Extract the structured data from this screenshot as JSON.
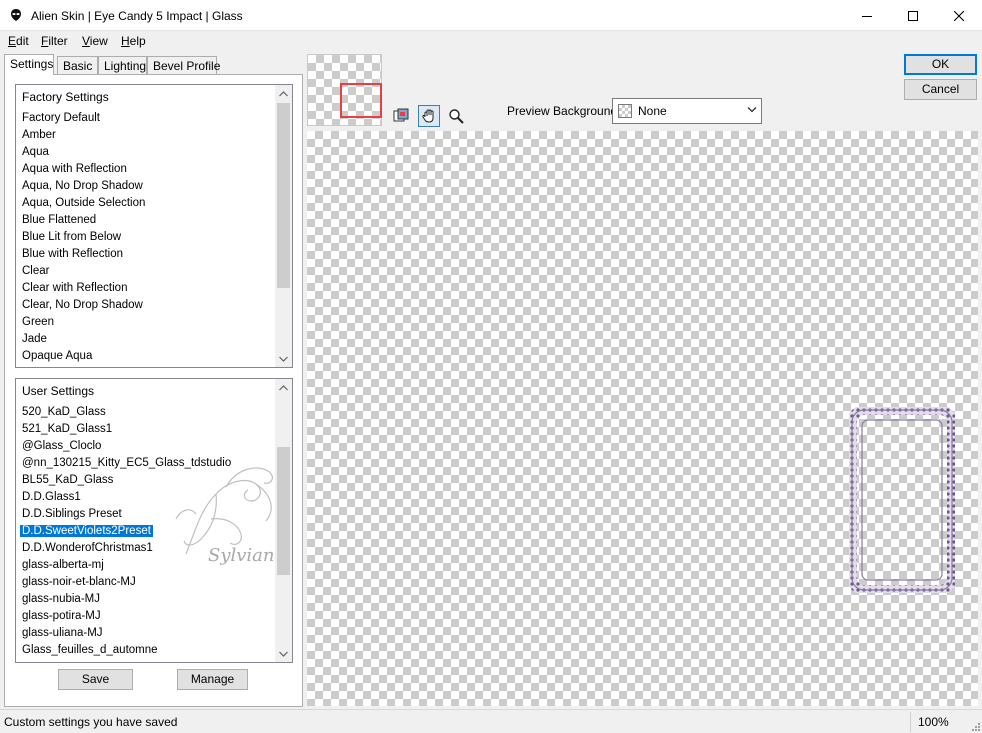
{
  "window": {
    "title": "Alien Skin | Eye Candy 5 Impact | Glass",
    "buttons": [
      "minimize-icon",
      "maximize-icon",
      "close-icon"
    ]
  },
  "menu": {
    "items": [
      {
        "mnemonic": "E",
        "rest": "dit"
      },
      {
        "mnemonic": "F",
        "rest": "ilter"
      },
      {
        "mnemonic": "V",
        "rest": "iew"
      },
      {
        "mnemonic": "H",
        "rest": "elp"
      }
    ]
  },
  "tabs": [
    "Settings",
    "Basic",
    "Lighting",
    "Bevel Profile"
  ],
  "factory": {
    "header": "Factory Settings",
    "items": [
      "Factory Default",
      "Amber",
      "Aqua",
      "Aqua with Reflection",
      "Aqua, No Drop Shadow",
      "Aqua, Outside Selection",
      "Blue Flattened",
      "Blue Lit from Below",
      "Blue with Reflection",
      "Clear",
      "Clear with Reflection",
      "Clear, No Drop Shadow",
      "Green",
      "Jade",
      "Opaque Aqua"
    ]
  },
  "user": {
    "header": "User Settings",
    "selected_index": 7,
    "items": [
      "520_KaD_Glass",
      "521_KaD_Glass1",
      "@Glass_Cloclo",
      "@nn_130215_Kitty_EC5_Glass_tdstudio",
      "BL55_KaD_Glass",
      "D.D.Glass1",
      "D.D.Siblings Preset",
      "D.D.SweetViolets2Preset",
      "D.D.WonderofChristmas1",
      "glass-alberta-mj",
      "glass-noir-et-blanc-MJ",
      "glass-nubia-MJ",
      "glass-potira-MJ",
      "glass-uliana-MJ",
      "Glass_feuilles_d_automne"
    ]
  },
  "watermark": "Sylviane",
  "actions": {
    "save": "Save",
    "manage": "Manage",
    "ok": "OK",
    "cancel": "Cancel"
  },
  "preview": {
    "background_label": "Preview Background:",
    "background_value": "None",
    "tools": [
      "preview-toggle-icon",
      "hand-icon",
      "zoom-icon"
    ]
  },
  "status": {
    "message": "Custom settings you have saved",
    "zoom": "100%"
  },
  "colors": {
    "selection": "#0078d7",
    "nav_rect": "#e84040",
    "checker": "#cccccc",
    "frame": "#8a7aa0"
  }
}
